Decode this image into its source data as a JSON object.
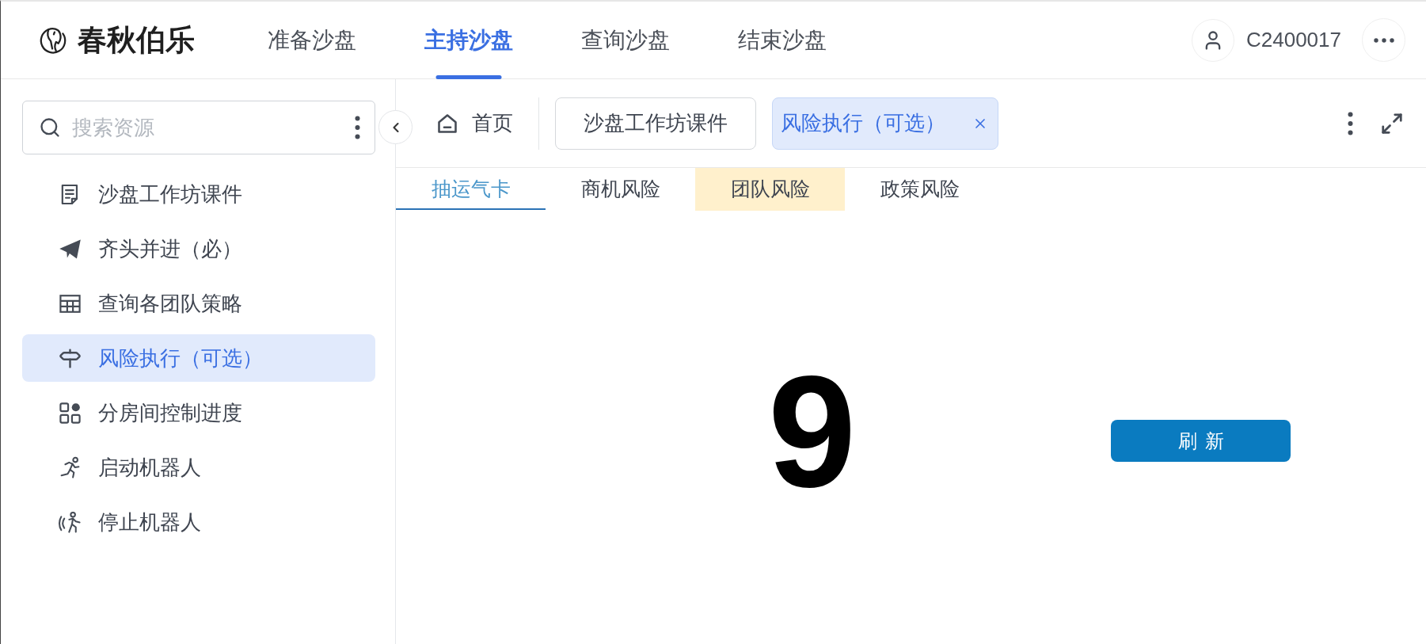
{
  "header": {
    "brand": "春秋伯乐",
    "nav": [
      {
        "label": "准备沙盘",
        "selected": false
      },
      {
        "label": "主持沙盘",
        "selected": true
      },
      {
        "label": "查询沙盘",
        "selected": false
      },
      {
        "label": "结束沙盘",
        "selected": false
      }
    ],
    "user": {
      "id": "C2400017"
    }
  },
  "sidebar": {
    "search": {
      "placeholder": "搜索资源"
    },
    "items": [
      {
        "label": "沙盘工作坊课件",
        "selected": false
      },
      {
        "label": "齐头并进（必）",
        "selected": false
      },
      {
        "label": "查询各团队策略",
        "selected": false
      },
      {
        "label": "风险执行（可选）",
        "selected": true
      },
      {
        "label": "分房间控制进度",
        "selected": false
      },
      {
        "label": "启动机器人",
        "selected": false
      },
      {
        "label": "停止机器人",
        "selected": false
      }
    ]
  },
  "tab_bar": {
    "home": "首页",
    "tabs": [
      {
        "label": "沙盘工作坊课件",
        "selected": false,
        "closable": false
      },
      {
        "label": "风险执行（可选）",
        "selected": true,
        "closable": true
      }
    ]
  },
  "sub_tabs": [
    {
      "label": "抽运气卡",
      "selected": true,
      "highlighted": false
    },
    {
      "label": "商机风险",
      "selected": false,
      "highlighted": false
    },
    {
      "label": "团队风险",
      "selected": false,
      "highlighted": true
    },
    {
      "label": "政策风险",
      "selected": false,
      "highlighted": false
    }
  ],
  "content": {
    "value": "9",
    "refresh_button": "刷新"
  }
}
